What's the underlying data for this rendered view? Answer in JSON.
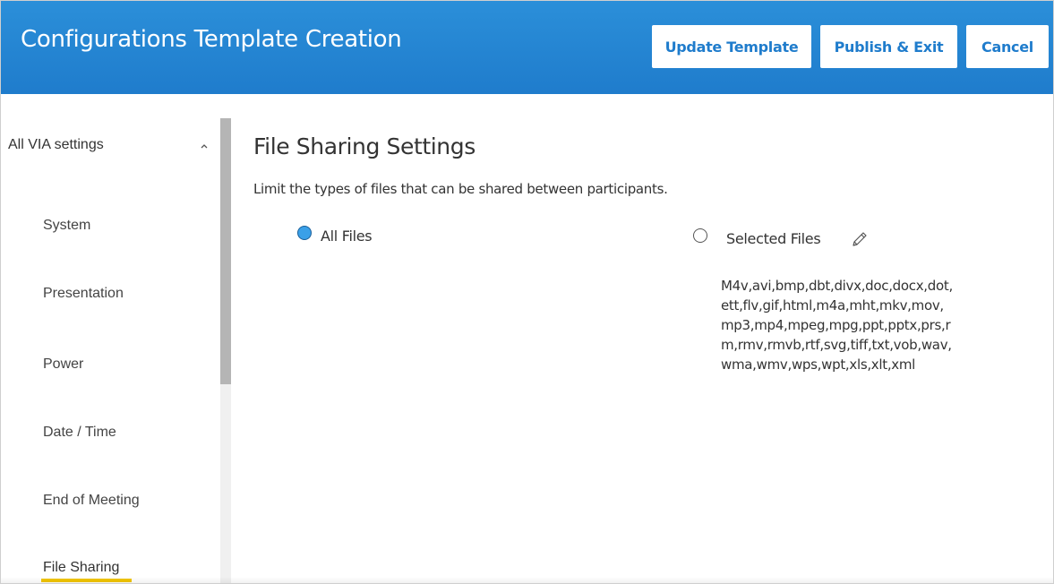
{
  "header": {
    "title": "Configurations Template Creation",
    "buttons": {
      "update": "Update Template",
      "publish": "Publish & Exit",
      "cancel": "Cancel"
    },
    "background_color": "#1f7ccc"
  },
  "sidebar": {
    "group_label": "All VIA settings",
    "group_icon": "chevron-up-icon",
    "items": [
      {
        "label": "System"
      },
      {
        "label": "Presentation"
      },
      {
        "label": "Power"
      },
      {
        "label": "Date / Time"
      },
      {
        "label": "End of Meeting"
      },
      {
        "label": "File Sharing",
        "active": true
      }
    ],
    "active_color": "#f2c500"
  },
  "main": {
    "title": "File Sharing Settings",
    "description": "Limit the types of files that can be shared between participants.",
    "options": [
      {
        "label": "All Files",
        "selected": true
      },
      {
        "label": "Selected Files",
        "selected": false,
        "edit_icon": "pencil-icon"
      }
    ],
    "file_types": "M4v,avi,bmp,dbt,divx,doc,docx,dot,ett,flv,gif,html,m4a,mht,mkv,mov,mp3,mp4,mpeg,mpg,ppt,pptx,prs,rm,rmv,rmvb,rtf,svg,tiff,txt,vob,wav,wma,wmv,wps,wpt,xls,xlt,xml",
    "radio_selected_color": "#3aa0e8"
  }
}
